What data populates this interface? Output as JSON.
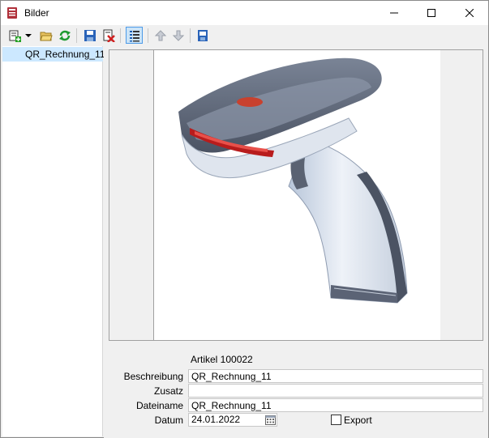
{
  "window": {
    "title": "Bilder"
  },
  "toolbar": {
    "icons": [
      "new-icon",
      "dropdown-arrow-icon",
      "open-folder-icon",
      "refresh-icon",
      "save-icon",
      "delete-icon",
      "list-view-icon",
      "move-up-icon",
      "move-down-icon",
      "export-icon"
    ]
  },
  "list": {
    "items": [
      {
        "label": "QR_Rechnung_11",
        "selected": true
      }
    ]
  },
  "details": {
    "article": "Artikel 100022",
    "fields": {
      "beschreibung_label": "Beschreibung",
      "beschreibung_value": "QR_Rechnung_11",
      "zusatz_label": "Zusatz",
      "zusatz_value": "",
      "dateiname_label": "Dateiname",
      "dateiname_value": "QR_Rechnung_11",
      "datum_label": "Datum",
      "datum_value": "24.01.2022"
    },
    "export_label": "Export",
    "export_checked": false
  },
  "colors": {
    "selection": "#cce8ff",
    "accent": "#1a73c8"
  }
}
